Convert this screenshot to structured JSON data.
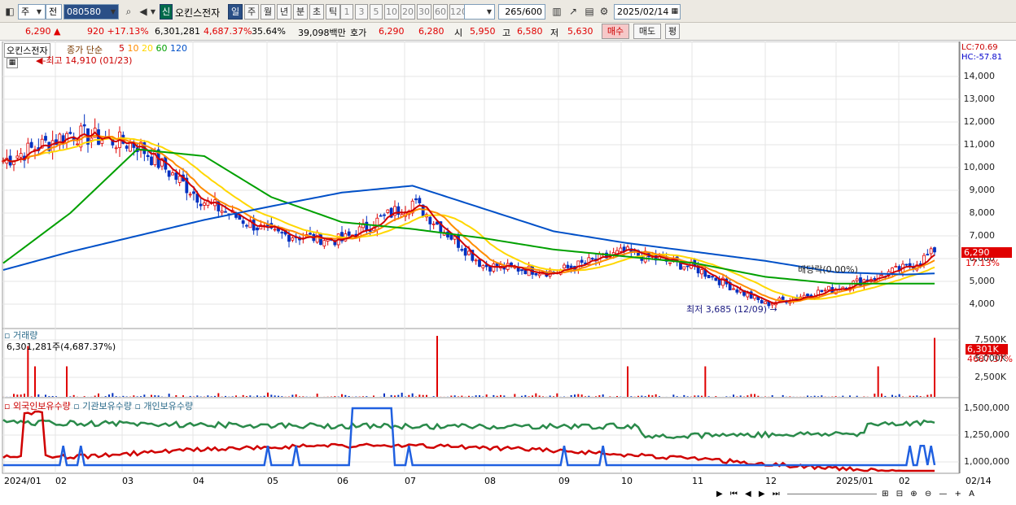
{
  "toolbar": {
    "market": "주",
    "ref": "전",
    "code": "080580",
    "name": "오킨스전자",
    "tag": "신",
    "periods": [
      "일",
      "주",
      "월",
      "년",
      "분",
      "초",
      "틱"
    ],
    "nums": [
      "1",
      "3",
      "5",
      "10",
      "20",
      "30",
      "60",
      "120"
    ],
    "count": "265",
    "count_total": "/600",
    "date": "2025/02/14"
  },
  "quote": {
    "price": "6,290",
    "arrow": "▲",
    "change": "920",
    "pct": "+17.13%",
    "volume": "6,301,281",
    "vol_pct": "4,687.37%",
    "turnover_pct": "35.64%",
    "amount": "39,098백만",
    "bid_label": "호가",
    "bid1": "6,290",
    "bid2": "6,280",
    "open_label": "시",
    "open": "5,950",
    "high_label": "고",
    "high": "6,580",
    "low_label": "저",
    "low": "5,630",
    "buy": "매수",
    "sell": "매도",
    "avg": "평"
  },
  "legend": {
    "name": "오킨스전자",
    "close": "종가 단순",
    "ma": [
      "5",
      "10",
      "20",
      "60",
      "120"
    ],
    "ma_colors": [
      "#d00000",
      "#ff8c00",
      "#ffd700",
      "#00a000",
      "#0050c8"
    ]
  },
  "price_axis": {
    "labels": [
      "14,000",
      "13,000",
      "12,000",
      "11,000",
      "10,000",
      "9,000",
      "8,000",
      "7,000",
      "6,000",
      "5,000",
      "4,000"
    ],
    "lc": "LC:70.69",
    "hc": "HC:-57.81",
    "current": "6,290",
    "current_pct": "17.13%"
  },
  "annotations": {
    "max": "최고 14,910 (01/23)",
    "min": "최저 3,685 (12/09)",
    "dividend": "배당락(0.00%)"
  },
  "volume": {
    "title": "거래량",
    "value": "6,301,281주(4,687.37%)",
    "axis": [
      "7,500K",
      "5,000K",
      "2,500K"
    ],
    "current": "6,301K",
    "current_pct": "4687.37%"
  },
  "holdings": {
    "series": [
      "외국인보유수량",
      "기관보유수량",
      "개인보유수량"
    ],
    "axis": [
      "1,500,000",
      "1,250,000",
      "1,000,000"
    ]
  },
  "xaxis": [
    "2024/01",
    "02",
    "03",
    "04",
    "05",
    "06",
    "07",
    "08",
    "09",
    "10",
    "11",
    "12",
    "2025/01",
    "02",
    "02/14"
  ],
  "chart_data": {
    "type": "line",
    "title": "오킨스전자",
    "x": [
      "2024/01",
      "02",
      "03",
      "04",
      "05",
      "06",
      "07",
      "08",
      "09",
      "10",
      "11",
      "12",
      "2025/01",
      "02",
      "02/14"
    ],
    "series": [
      {
        "name": "종가",
        "values": [
          10300,
          11500,
          11000,
          8500,
          7100,
          6800,
          8500,
          5700,
          5400,
          6300,
          5600,
          4000,
          4700,
          5600,
          6290
        ]
      },
      {
        "name": "120",
        "values": [
          5500,
          6300,
          7000,
          7700,
          8300,
          8900,
          9200,
          8200,
          7200,
          6700,
          6300,
          5900,
          5400,
          5300,
          5350
        ]
      },
      {
        "name": "60",
        "values": [
          5800,
          8000,
          10800,
          10500,
          8700,
          7600,
          7300,
          6900,
          6400,
          6100,
          5800,
          5200,
          4900,
          4900,
          4900
        ]
      }
    ],
    "ylim": [
      3300,
      15000
    ]
  }
}
